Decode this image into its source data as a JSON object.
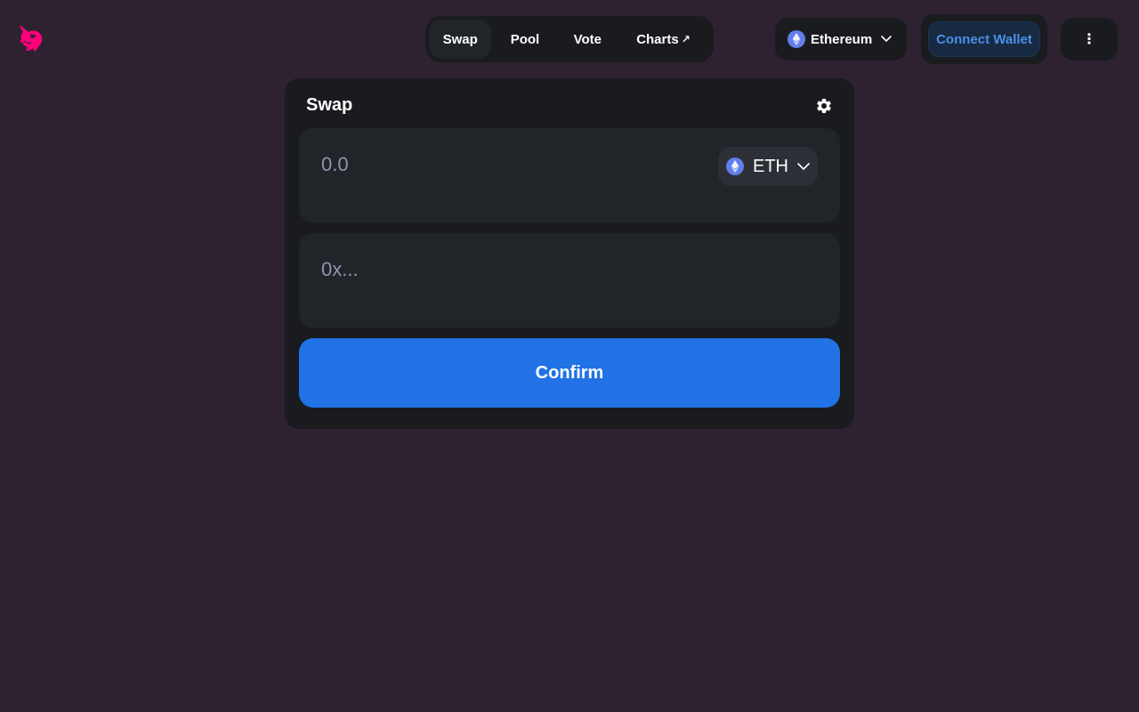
{
  "brand": {
    "color": "#ff007a",
    "logo_icon": "unicorn-logo-icon"
  },
  "nav": {
    "tabs": [
      {
        "label": "Swap",
        "active": true
      },
      {
        "label": "Pool",
        "active": false
      },
      {
        "label": "Vote",
        "active": false
      },
      {
        "label": "Charts",
        "active": false,
        "icon": "external-arrow-icon"
      }
    ],
    "charts_arrow": "↗"
  },
  "network": {
    "label": "Ethereum",
    "icon": "ethereum-icon"
  },
  "wallet": {
    "connect_label": "Connect Wallet"
  },
  "more": {
    "icon": "more-vertical-icon",
    "glyph": "⋮"
  },
  "swap": {
    "title": "Swap",
    "settings_icon": "gear-icon",
    "amount": {
      "value": "",
      "placeholder": "0.0"
    },
    "token": {
      "symbol": "ETH",
      "icon": "ethereum-icon"
    },
    "recipient": {
      "value": "",
      "placeholder": "0x..."
    },
    "confirm_label": "Confirm"
  },
  "colors": {
    "background": "#2e2230",
    "card": "#191b1f",
    "field": "#212429",
    "accent": "#2172e5",
    "wallet_text": "#4b8fe8",
    "eth": "#627eea"
  }
}
